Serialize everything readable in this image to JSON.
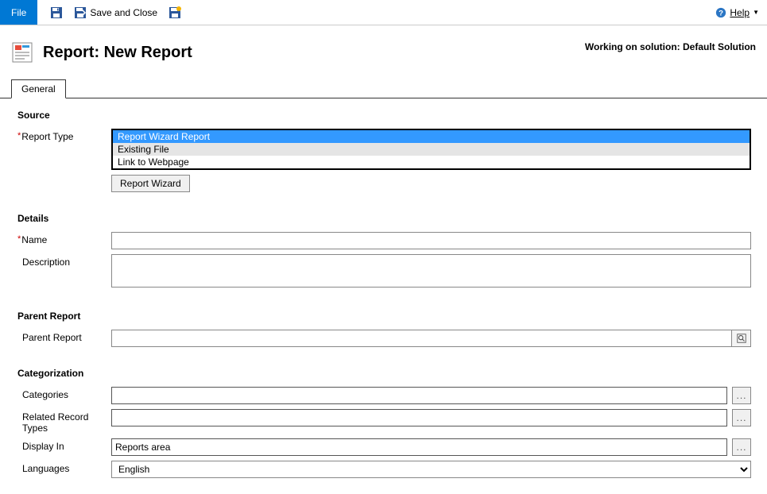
{
  "toolbar": {
    "file": "File",
    "save_and_close": "Save and Close",
    "help": "Help"
  },
  "header": {
    "title": "Report: New Report",
    "solution": "Working on solution: Default Solution"
  },
  "tabs": {
    "general": "General"
  },
  "sections": {
    "source": "Source",
    "details": "Details",
    "parent_report": "Parent Report",
    "categorization": "Categorization"
  },
  "labels": {
    "report_type": "Report Type",
    "name": "Name",
    "description": "Description",
    "parent_report": "Parent Report",
    "categories": "Categories",
    "related_record_types": "Related Record Types",
    "display_in": "Display In",
    "languages": "Languages"
  },
  "report_type_options": {
    "wizard": "Report Wizard Report",
    "existing": "Existing File",
    "link": "Link to Webpage"
  },
  "buttons": {
    "report_wizard": "Report Wizard",
    "ellipsis": "...",
    "lookup": "🔍"
  },
  "values": {
    "name": "",
    "description": "",
    "parent_report": "",
    "categories": "",
    "related_record_types": "",
    "display_in": "Reports area",
    "languages": "English"
  }
}
